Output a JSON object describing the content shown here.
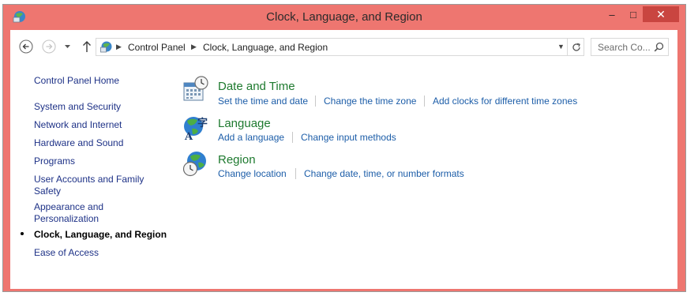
{
  "window": {
    "title": "Clock, Language, and Region",
    "controls": {
      "minimize": "–",
      "maximize": "□",
      "close": "✕"
    },
    "accent": "#ee7670"
  },
  "address": {
    "crumbs": [
      "Control Panel",
      "Clock, Language, and Region"
    ]
  },
  "search": {
    "placeholder": "Search Co..."
  },
  "sidebar": {
    "items": [
      {
        "label": "Control Panel Home"
      },
      {
        "label": "System and Security"
      },
      {
        "label": "Network and Internet"
      },
      {
        "label": "Hardware and Sound"
      },
      {
        "label": "Programs"
      },
      {
        "label": "User Accounts and Family",
        "label2": "Safety"
      },
      {
        "label": "Appearance and",
        "label2": "Personalization"
      },
      {
        "label": "Clock, Language, and Region",
        "current": true
      },
      {
        "label": "Ease of Access"
      }
    ]
  },
  "categories": [
    {
      "icon": "clock-calendar-icon",
      "title": "Date and Time",
      "tasks": [
        "Set the time and date",
        "Change the time zone",
        "Add clocks for different time zones"
      ]
    },
    {
      "icon": "language-globe-icon",
      "title": "Language",
      "tasks": [
        "Add a language",
        "Change input methods"
      ]
    },
    {
      "icon": "region-globe-clock-icon",
      "title": "Region",
      "tasks": [
        "Change location",
        "Change date, time, or number formats"
      ]
    }
  ]
}
